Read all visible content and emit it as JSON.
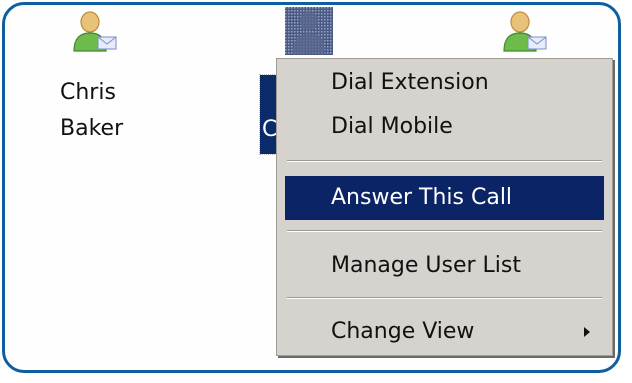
{
  "users": [
    {
      "name": "Chris\nBaker",
      "status": "available",
      "icon": "user-mail-icon"
    },
    {
      "name": "C",
      "status": "selected",
      "icon": "user-offline-icon"
    },
    {
      "name": "",
      "status": "available",
      "icon": "user-mail-icon"
    }
  ],
  "context_menu": {
    "items": [
      {
        "label": "Dial Extension"
      },
      {
        "label": "Dial Mobile"
      },
      {
        "label": "Answer This Call"
      },
      {
        "label": "Manage User List"
      },
      {
        "label": "Change View"
      }
    ]
  },
  "colors": {
    "frame_border": "#0f5fa0",
    "menu_bg": "#d6d3ce",
    "highlight": "#0a2466",
    "user_green": "#6dbb4a"
  }
}
